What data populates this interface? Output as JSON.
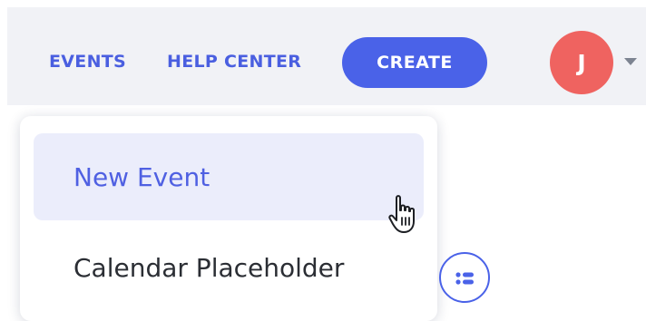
{
  "header": {
    "nav": {
      "events_label": "EVENTS",
      "help_center_label": "HELP CENTER"
    },
    "create_label": "CREATE",
    "avatar_initial": "J",
    "avatar_caret_icon": "caret-down-icon"
  },
  "dropdown": {
    "items": [
      {
        "label": "New Event",
        "state": "hovered"
      },
      {
        "label": "Calendar Placeholder"
      }
    ]
  },
  "floating_button": {
    "icon": "list-icon"
  },
  "colors": {
    "accent": "#4a62e8",
    "avatar": "#ef6360",
    "topbar_background": "#f1f2f6",
    "hover_background": "#ebedfb"
  }
}
